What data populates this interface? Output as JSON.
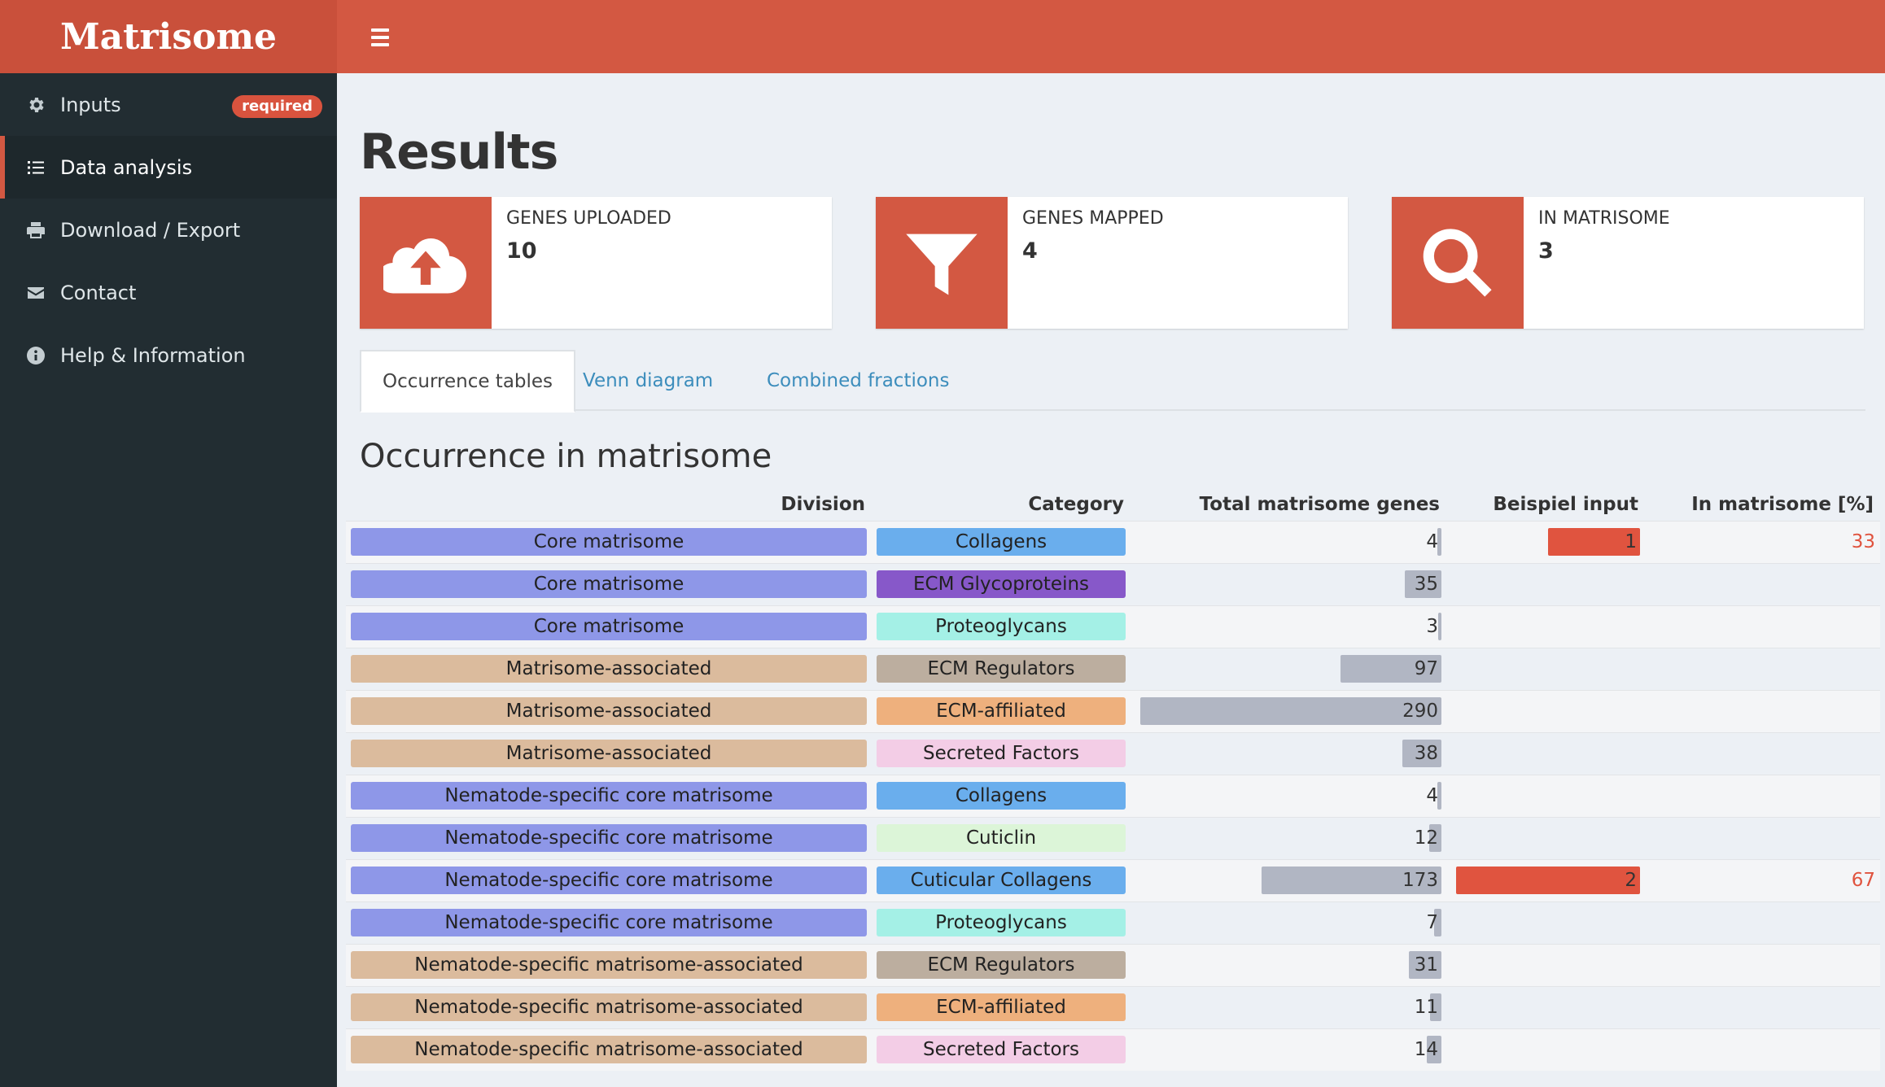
{
  "app": {
    "title": "Matrisome"
  },
  "sidebar": {
    "items": [
      {
        "label": "Inputs",
        "icon": "gear-icon",
        "badge": "required"
      },
      {
        "label": "Data analysis",
        "icon": "list-icon"
      },
      {
        "label": "Download / Export",
        "icon": "printer-icon"
      },
      {
        "label": "Contact",
        "icon": "envelope-icon"
      },
      {
        "label": "Help & Information",
        "icon": "info-icon"
      }
    ]
  },
  "main": {
    "title": "Results",
    "stats": [
      {
        "label": "GENES UPLOADED",
        "value": "10",
        "icon": "cloud-upload-icon"
      },
      {
        "label": "GENES MAPPED",
        "value": "4",
        "icon": "filter-icon"
      },
      {
        "label": "IN MATRISOME",
        "value": "3",
        "icon": "search-icon"
      }
    ],
    "tabs": [
      "Occurrence tables",
      "Venn diagram",
      "Combined fractions"
    ],
    "section_title": "Occurrence in matrisome",
    "table": {
      "headers": [
        "Division",
        "Category",
        "Total matrisome genes",
        "Beispiel input",
        "In matrisome [%]"
      ],
      "max_total": 290,
      "max_input": 2,
      "rows": [
        {
          "division": "Core matrisome",
          "category": "Collagens",
          "total": 4,
          "input": 1,
          "pct": "33"
        },
        {
          "division": "Core matrisome",
          "category": "ECM Glycoproteins",
          "total": 35,
          "input": null,
          "pct": ""
        },
        {
          "division": "Core matrisome",
          "category": "Proteoglycans",
          "total": 3,
          "input": null,
          "pct": ""
        },
        {
          "division": "Matrisome-associated",
          "category": "ECM Regulators",
          "total": 97,
          "input": null,
          "pct": ""
        },
        {
          "division": "Matrisome-associated",
          "category": "ECM-affiliated",
          "total": 290,
          "input": null,
          "pct": ""
        },
        {
          "division": "Matrisome-associated",
          "category": "Secreted Factors",
          "total": 38,
          "input": null,
          "pct": ""
        },
        {
          "division": "Nematode-specific core matrisome",
          "category": "Collagens",
          "total": 4,
          "input": null,
          "pct": ""
        },
        {
          "division": "Nematode-specific core matrisome",
          "category": "Cuticlin",
          "total": 12,
          "input": null,
          "pct": ""
        },
        {
          "division": "Nematode-specific core matrisome",
          "category": "Cuticular Collagens",
          "total": 173,
          "input": 2,
          "pct": "67"
        },
        {
          "division": "Nematode-specific core matrisome",
          "category": "Proteoglycans",
          "total": 7,
          "input": null,
          "pct": ""
        },
        {
          "division": "Nematode-specific matrisome-associated",
          "category": "ECM Regulators",
          "total": 31,
          "input": null,
          "pct": ""
        },
        {
          "division": "Nematode-specific matrisome-associated",
          "category": "ECM-affiliated",
          "total": 11,
          "input": null,
          "pct": ""
        },
        {
          "division": "Nematode-specific matrisome-associated",
          "category": "Secreted Factors",
          "total": 14,
          "input": null,
          "pct": ""
        }
      ]
    }
  },
  "colors": {
    "accent": "#d35842",
    "division": {
      "Core matrisome": "#8e97e8",
      "Matrisome-associated": "#dbbb9d",
      "Nematode-specific core matrisome": "#8e97e8",
      "Nematode-specific matrisome-associated": "#dbbb9d"
    },
    "category": {
      "Collagens": "#6aaeed",
      "ECM Glycoproteins": "#8758c9",
      "Proteoglycans": "#a4f0e6",
      "ECM Regulators": "#bcae9f",
      "ECM-affiliated": "#eeb07d",
      "Secreted Factors": "#f3cde6",
      "Cuticlin": "#dcf5d8",
      "Cuticular Collagens": "#6aaeed"
    }
  }
}
